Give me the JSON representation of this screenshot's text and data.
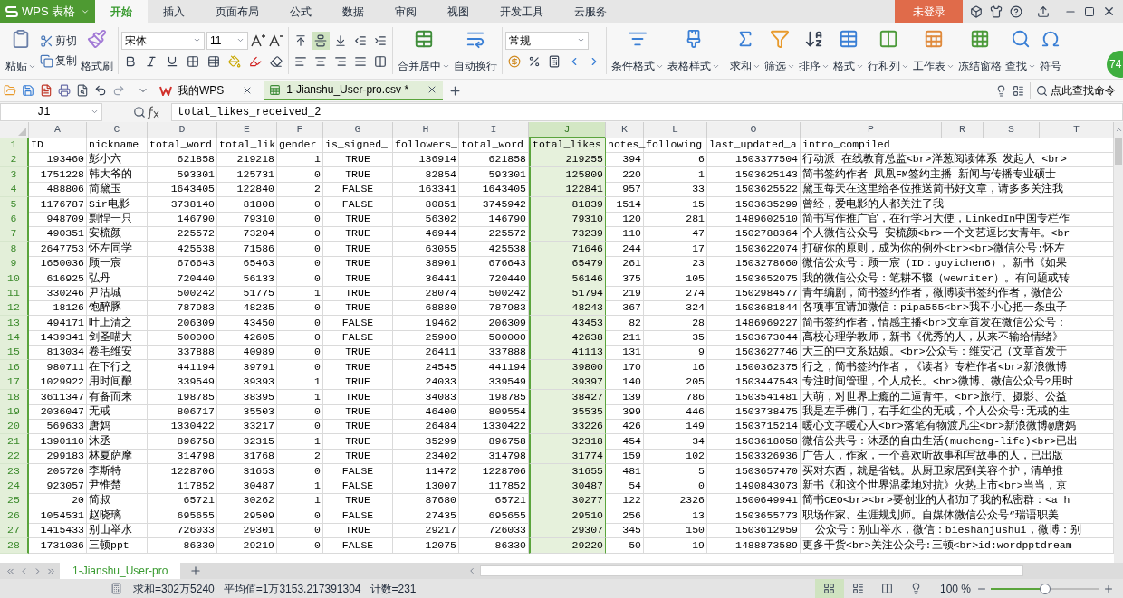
{
  "app": {
    "title": "WPS 表格"
  },
  "menu_tabs": [
    {
      "label": "开始",
      "selected": true
    },
    {
      "label": "插入",
      "selected": false
    },
    {
      "label": "页面布局",
      "selected": false
    },
    {
      "label": "公式",
      "selected": false
    },
    {
      "label": "数据",
      "selected": false
    },
    {
      "label": "审阅",
      "selected": false
    },
    {
      "label": "视图",
      "selected": false
    },
    {
      "label": "开发工具",
      "selected": false
    },
    {
      "label": "云服务",
      "selected": false
    }
  ],
  "login_button": "未登录",
  "ribbon": {
    "paste": "粘贴",
    "cut": "剪切",
    "copy": "复制",
    "format_painter": "格式刷",
    "font_family": "宋体",
    "font_size": "11",
    "vertical_align": [
      {
        "selected": false
      },
      {
        "selected": true
      },
      {
        "selected": false
      }
    ],
    "merge": "合并居中",
    "wrap": "自动换行",
    "number_format": "常规",
    "styles": [
      {
        "label": "条件格式",
        "dropdown": true
      },
      {
        "label": "表格样式",
        "dropdown": true
      }
    ],
    "tools": [
      {
        "kind": "sum",
        "label": "求和",
        "dropdown": true
      },
      {
        "kind": "filter",
        "label": "筛选",
        "dropdown": true
      },
      {
        "kind": "sort",
        "label": "排序",
        "dropdown": true
      },
      {
        "kind": "format",
        "label": "格式",
        "dropdown": true
      },
      {
        "kind": "rowcol",
        "label": "行和列",
        "dropdown": true
      },
      {
        "kind": "sheet",
        "label": "工作表",
        "dropdown": true
      },
      {
        "kind": "freeze",
        "label": "冻结窗格",
        "dropdown": false
      },
      {
        "kind": "find",
        "label": "查找",
        "dropdown": true
      },
      {
        "kind": "symbol",
        "label": "符号",
        "dropdown": false
      }
    ]
  },
  "badge": "74",
  "doc_tabs": [
    {
      "label": "我的WPS",
      "selected": false
    },
    {
      "label": "1-Jianshu_User-pro.csv *",
      "selected": true
    }
  ],
  "command_search": "点此查找命令",
  "formula_bar": {
    "cell": "J1",
    "value": "total_likes_received_2"
  },
  "table": {
    "columns": [
      {
        "letter": "A",
        "selected": false
      },
      {
        "letter": "C",
        "selected": false
      },
      {
        "letter": "D",
        "selected": false
      },
      {
        "letter": "E",
        "selected": false
      },
      {
        "letter": "F",
        "selected": false
      },
      {
        "letter": "G",
        "selected": false
      },
      {
        "letter": "H",
        "selected": false
      },
      {
        "letter": "I",
        "selected": false
      },
      {
        "letter": "J",
        "selected": true
      },
      {
        "letter": "K",
        "selected": false
      },
      {
        "letter": "L",
        "selected": false
      },
      {
        "letter": "O",
        "selected": false
      },
      {
        "letter": "P",
        "selected": false
      },
      {
        "letter": "R",
        "selected": false
      },
      {
        "letter": "S",
        "selected": false
      },
      {
        "letter": "T",
        "selected": false
      }
    ],
    "rows": [
      {
        "number": "1",
        "cells": [
          "ID",
          "nickname",
          "total_word",
          "total_lik",
          "gender",
          "is_signed_",
          "followers_",
          "total_word",
          "total_likes",
          "notes_",
          "following",
          "last_updated_a",
          "intro_compiled"
        ]
      },
      {
        "number": "2",
        "cells": [
          "193460",
          "彭小六",
          "621858",
          "219218",
          "1",
          "TRUE",
          "136914",
          "621858",
          "219255",
          "394",
          "6",
          "1503377504",
          "行动派 在线教育总监<br>洋葱阅读体系 发起人 <br>"
        ]
      },
      {
        "number": "3",
        "cells": [
          "1751228",
          "韩大爷的",
          "593301",
          "125731",
          "0",
          "TRUE",
          "82854",
          "593301",
          "125809",
          "220",
          "1",
          "1503625143",
          "简书签约作者 凤凰FM签约主播 新闻与传播专业硕士"
        ]
      },
      {
        "number": "4",
        "cells": [
          "488806",
          "简黛玉",
          "1643405",
          "122840",
          "2",
          "FALSE",
          "163341",
          "1643405",
          "122841",
          "957",
          "33",
          "1503625522",
          "黛玉每天在这里给各位推送简书好文章，请多多关注我"
        ]
      },
      {
        "number": "5",
        "cells": [
          "1176787",
          "Sir电影",
          "3738140",
          "81808",
          "0",
          "FALSE",
          "80851",
          "3745942",
          "81839",
          "1514",
          "15",
          "1503635299",
          "曾经，爱电影的人都关注了我"
        ]
      },
      {
        "number": "6",
        "cells": [
          "948709",
          "剽悍一只",
          "146790",
          "79310",
          "0",
          "TRUE",
          "56302",
          "146790",
          "79310",
          "120",
          "281",
          "1489602510",
          "简书写作推广官，在行学习大使，LinkedIn中国专栏作"
        ]
      },
      {
        "number": "7",
        "cells": [
          "490351",
          "安梳颜",
          "225572",
          "73204",
          "0",
          "TRUE",
          "46944",
          "225572",
          "73239",
          "110",
          "47",
          "1502788364",
          "个人微信公众号 安梳颜<br>一个文艺逗比女青年。<br"
        ]
      },
      {
        "number": "8",
        "cells": [
          "2647753",
          "怀左同学",
          "425538",
          "71586",
          "0",
          "TRUE",
          "63055",
          "425538",
          "71646",
          "244",
          "17",
          "1503622074",
          "打破你的原则，成为你的例外<br><br>微信公号:怀左"
        ]
      },
      {
        "number": "9",
        "cells": [
          "1650036",
          "顾一宸",
          "676643",
          "65463",
          "0",
          "TRUE",
          "38901",
          "676643",
          "65479",
          "261",
          "23",
          "1503278660",
          "微信公众号：顾一宸（ID：guyichen6）。新书《如果"
        ]
      },
      {
        "number": "10",
        "cells": [
          "616925",
          "弘丹",
          "720440",
          "56133",
          "0",
          "TRUE",
          "36441",
          "720440",
          "56146",
          "375",
          "105",
          "1503652075",
          "我的微信公众号：笔耕不辍（wewriter）。有问题或转"
        ]
      },
      {
        "number": "11",
        "cells": [
          "330246",
          "尹沽城",
          "500242",
          "51775",
          "1",
          "TRUE",
          "28074",
          "500242",
          "51794",
          "219",
          "274",
          "1502984577",
          "青年编剧，简书签约作者，微博读书签约作者，微信公"
        ]
      },
      {
        "number": "12",
        "cells": [
          "18126",
          "饱醉豚",
          "787983",
          "48235",
          "0",
          "TRUE",
          "68880",
          "787983",
          "48243",
          "367",
          "324",
          "1503681844",
          "各项事宜请加微信：pipa555<br>我不小心把一条虫子"
        ]
      },
      {
        "number": "13",
        "cells": [
          "494171",
          "叶上清之",
          "206309",
          "43450",
          "0",
          "FALSE",
          "19462",
          "206309",
          "43453",
          "82",
          "28",
          "1486969227",
          "简书签约作者，情感主播<br>文章首发在微信公众号："
        ]
      },
      {
        "number": "14",
        "cells": [
          "1439341",
          "剑圣喵大",
          "500000",
          "42605",
          "0",
          "FALSE",
          "25900",
          "500000",
          "42638",
          "211",
          "35",
          "1503673044",
          "高校心理学教师，新书《优秀的人，从来不输给情绪》"
        ]
      },
      {
        "number": "15",
        "cells": [
          "813034",
          "卷毛维安",
          "337888",
          "40989",
          "0",
          "TRUE",
          "26411",
          "337888",
          "41113",
          "131",
          "9",
          "1503627746",
          "大三的中文系姑娘。<br>公众号：维安记（文章首发于"
        ]
      },
      {
        "number": "16",
        "cells": [
          "980711",
          "在下行之",
          "441194",
          "39791",
          "0",
          "TRUE",
          "24545",
          "441194",
          "39800",
          "170",
          "16",
          "1500362375",
          "行之，简书签约作者，《读者》专栏作者<br>新浪微博"
        ]
      },
      {
        "number": "17",
        "cells": [
          "1029922",
          "用时间酿",
          "339549",
          "39393",
          "1",
          "TRUE",
          "24033",
          "339549",
          "39397",
          "140",
          "205",
          "1503447543",
          "专注时间管理，个人成长。<br>微博、微信公众号?用时"
        ]
      },
      {
        "number": "18",
        "cells": [
          "3611347",
          "有备而来",
          "198785",
          "38395",
          "1",
          "TRUE",
          "34083",
          "198785",
          "38427",
          "139",
          "786",
          "1503541481",
          "大萌，对世界上瘾的二逼青年。<br>旅行、摄影、公益"
        ]
      },
      {
        "number": "19",
        "cells": [
          "2036047",
          "无戒",
          "806717",
          "35503",
          "0",
          "TRUE",
          "46400",
          "809554",
          "35535",
          "399",
          "446",
          "1503738475",
          "我是左手佛门，右手红尘的无戒，个人公众号:无戒的生"
        ]
      },
      {
        "number": "20",
        "cells": [
          "569633",
          "唐妈",
          "1330422",
          "33217",
          "0",
          "TRUE",
          "26484",
          "1330422",
          "33226",
          "426",
          "149",
          "1503715214",
          "暖心文字暖心人<br>落笔有物渡凡尘<br>新浪微博@唐妈"
        ]
      },
      {
        "number": "21",
        "cells": [
          "1390110",
          "沐丞",
          "896758",
          "32315",
          "1",
          "TRUE",
          "35299",
          "896758",
          "32318",
          "454",
          "34",
          "1503618058",
          "微信公共号：沐丞的自由生活(mucheng-life)<br>已出"
        ]
      },
      {
        "number": "22",
        "cells": [
          "299183",
          "林夏萨摩",
          "314798",
          "31768",
          "2",
          "TRUE",
          "23402",
          "314798",
          "31774",
          "159",
          "102",
          "1503326936",
          "广告人，作家，一个喜欢听故事和写故事的人，已出版"
        ]
      },
      {
        "number": "23",
        "cells": [
          "205720",
          "李斯特",
          "1228706",
          "31653",
          "0",
          "FALSE",
          "11472",
          "1228706",
          "31655",
          "481",
          "5",
          "1503657470",
          "买对东西，就是省钱。从厨卫家居到美容个护，清单推"
        ]
      },
      {
        "number": "24",
        "cells": [
          "923057",
          "尹惟楚",
          "117852",
          "30487",
          "1",
          "FALSE",
          "13007",
          "117852",
          "30487",
          "54",
          "0",
          "1490843073",
          "新书《和这个世界温柔地对抗》火热上市<br>当当，京"
        ]
      },
      {
        "number": "25",
        "cells": [
          "20",
          "简叔",
          "65721",
          "30262",
          "1",
          "TRUE",
          "87680",
          "65721",
          "30277",
          "122",
          "2326",
          "1500649941",
          "简书CEO<br><br>要创业的人都加了我的私密群：<a h"
        ]
      },
      {
        "number": "26",
        "cells": [
          "1054531",
          "赵晓璃",
          "695655",
          "29509",
          "0",
          "FALSE",
          "27435",
          "695655",
          "29510",
          "256",
          "13",
          "1503655773",
          "职场作家、生涯规划师。自媒体微信公众号“瑞语职美"
        ]
      },
      {
        "number": "27",
        "cells": [
          "1415433",
          "别山举水",
          "726033",
          "29301",
          "0",
          "TRUE",
          "29217",
          "726033",
          "29307",
          "345",
          "150",
          "1503612959",
          "  公众号：别山举水，微信：bieshanjushui，微博：别"
        ]
      },
      {
        "number": "28",
        "cells": [
          "1731036",
          "三顿ppt",
          "86330",
          "29219",
          "0",
          "FALSE",
          "12075",
          "86330",
          "29220",
          "50",
          "19",
          "1488873589",
          "更多干货<br>关注公众号:三顿<br>id:wordpptdream"
        ]
      }
    ]
  },
  "sheet_tabs": [
    {
      "label": "1-Jianshu_User-pro",
      "selected": true
    }
  ],
  "status_bar": {
    "sum": "求和=302万5240",
    "average": "平均值=1万3153.217391304",
    "count": "计数=231",
    "views": [
      {
        "selected": true
      },
      {
        "selected": false
      },
      {
        "selected": false
      },
      {
        "selected": false
      }
    ],
    "zoom": {
      "text": "100 %",
      "level": 0.5
    }
  }
}
